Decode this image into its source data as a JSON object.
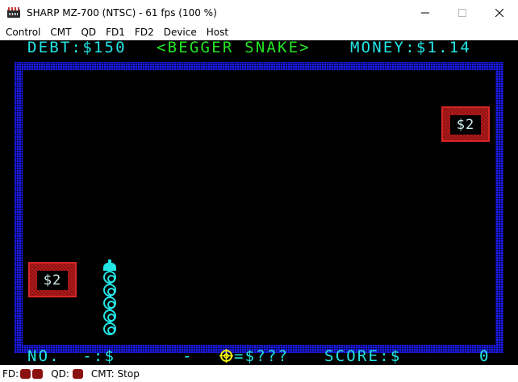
{
  "window": {
    "title": "SHARP MZ-700 (NTSC) - 61 fps (100 %)",
    "icon": "computer-icon"
  },
  "menu": {
    "items": [
      "Control",
      "CMT",
      "QD",
      "FD1",
      "FD2",
      "Device",
      "Host"
    ]
  },
  "game": {
    "debt_label": "DEBT:$150",
    "title": "<BEGGER SNAKE>",
    "money_label": "MONEY:$1.14",
    "money_boxes": [
      "$2",
      "$2"
    ],
    "bottom_no": "NO.  -:$",
    "bottom_dash": "-",
    "bottom_coin": "=$???",
    "bottom_score": "SCORE:$",
    "score_value": "0",
    "snake_length": 6
  },
  "status": {
    "fd_label": "FD:",
    "qd_label": "QD:",
    "cmt_label": "CMT: Stop"
  },
  "colors": {
    "screen_bg": "#000000",
    "text_cyan": "#22e6e6",
    "title_green": "#22e622",
    "border_blue": "#1c1cff",
    "money_red": "#b51a1a",
    "coin_yellow": "#f2f211",
    "led_red": "#8b1010"
  }
}
